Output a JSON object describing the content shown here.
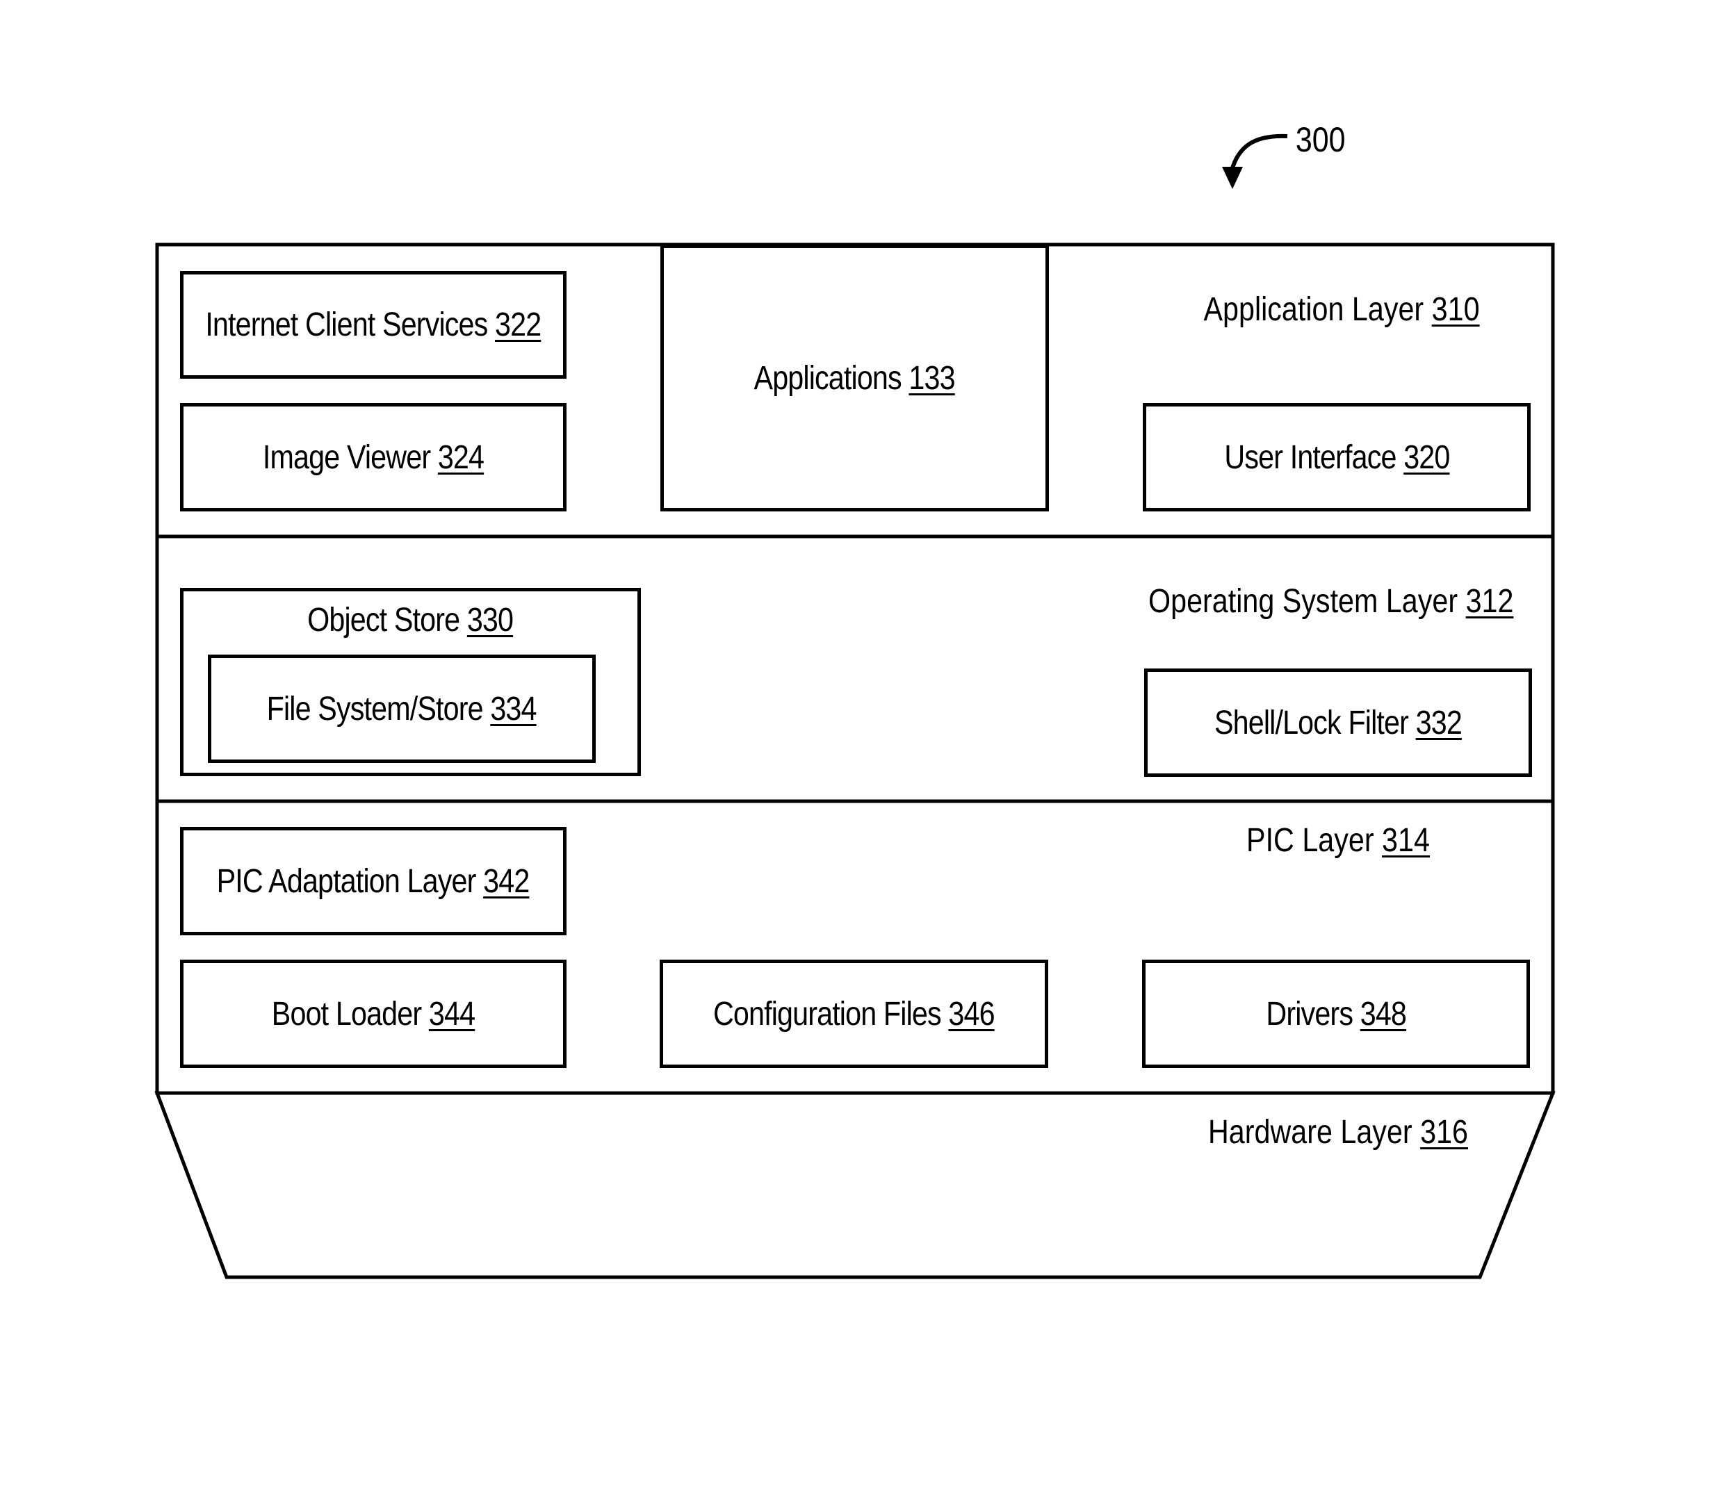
{
  "figure": {
    "ref": "300",
    "layers": {
      "application": {
        "name": "Application Layer",
        "ref": "310"
      },
      "operating_system": {
        "name": "Operating System Layer",
        "ref": "312"
      },
      "pic": {
        "name": "PIC Layer",
        "ref": "314"
      },
      "hardware": {
        "name": "Hardware Layer",
        "ref": "316"
      }
    },
    "components": {
      "internet_client_services": {
        "name": "Internet Client Services",
        "ref": "322"
      },
      "image_viewer": {
        "name": "Image Viewer",
        "ref": "324"
      },
      "applications": {
        "name": "Applications",
        "ref": "133"
      },
      "user_interface": {
        "name": "User Interface",
        "ref": "320"
      },
      "object_store": {
        "name": "Object Store",
        "ref": "330"
      },
      "file_system_store": {
        "name": "File System/Store",
        "ref": "334"
      },
      "shell_lock_filter": {
        "name": "Shell/Lock Filter",
        "ref": "332"
      },
      "pic_adaptation_layer": {
        "name": "PIC Adaptation Layer",
        "ref": "342"
      },
      "boot_loader": {
        "name": "Boot Loader",
        "ref": "344"
      },
      "configuration_files": {
        "name": "Configuration Files",
        "ref": "346"
      },
      "drivers": {
        "name": "Drivers",
        "ref": "348"
      }
    }
  }
}
